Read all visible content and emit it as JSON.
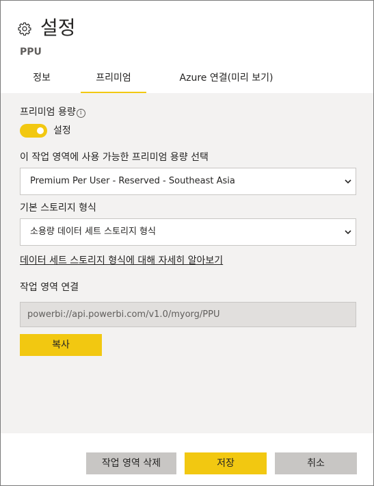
{
  "header": {
    "title": "설정",
    "subtitle": "PPU",
    "icon": "gear-icon"
  },
  "tabs": [
    {
      "label": "정보",
      "active": false
    },
    {
      "label": "프리미엄",
      "active": true
    },
    {
      "label": "Azure 연결(미리 보기)",
      "active": false
    }
  ],
  "premium": {
    "capacity_label": "프리미엄 용량",
    "toggle_state": "on",
    "toggle_label": "설정",
    "capacity_select_label": "이 작업 영역에 사용 가능한 프리미엄 용량 선택",
    "capacity_select_value": "Premium Per User - Reserved - Southeast Asia",
    "storage_label": "기본 스토리지 형식",
    "storage_select_value": "소용량 데이터 세트 스토리지 형식",
    "learn_more_link": "데이터 세트 스토리지 형식에 대해 자세히 알아보기",
    "connection_label": "작업 영역 연결",
    "connection_value": "powerbi://api.powerbi.com/v1.0/myorg/PPU",
    "copy_button": "복사"
  },
  "footer": {
    "delete_button": "작업 영역 삭제",
    "save_button": "저장",
    "cancel_button": "취소"
  },
  "colors": {
    "accent": "#f2c811",
    "panel_bg": "#f3f2f1",
    "gray_button": "#c8c6c4"
  }
}
